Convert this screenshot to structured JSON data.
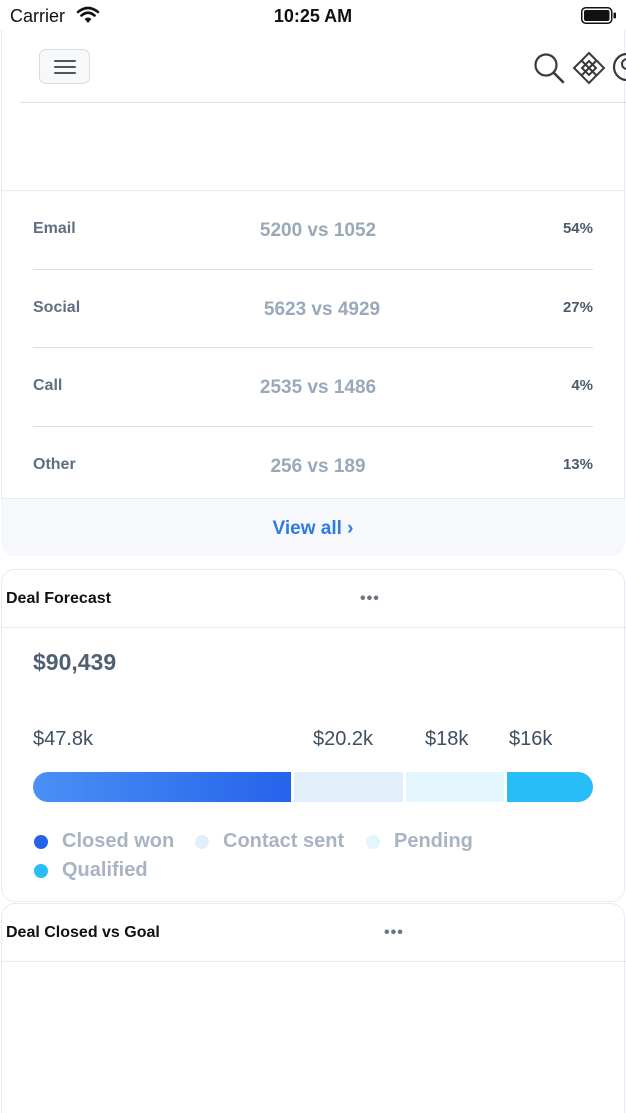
{
  "status_bar": {
    "carrier": "Carrier",
    "time": "10:25 AM"
  },
  "nav": {
    "menu_icon": "hamburger-icon",
    "search_icon": "search-icon",
    "apps_icon": "apps-icon",
    "avatar_icon": "user-avatar-icon"
  },
  "channels": {
    "rows": [
      {
        "label": "Email",
        "compare": "5200 vs 1052",
        "percent": "54%"
      },
      {
        "label": "Social",
        "compare": "5623 vs 4929",
        "percent": "27%"
      },
      {
        "label": "Call",
        "compare": "2535 vs 1486",
        "percent": "4%"
      },
      {
        "label": "Other",
        "compare": "256 vs 189",
        "percent": "13%"
      }
    ],
    "view_all": "View all ›"
  },
  "forecast": {
    "title": "Deal Forecast",
    "more": "•••",
    "total": "$90,439",
    "segments": [
      {
        "label": "Closed won",
        "amount": "$47.8k",
        "value": 47.8,
        "color": "#2563eb"
      },
      {
        "label": "Contact sent",
        "amount": "$20.2k",
        "value": 20.2,
        "color": "#e3eefb"
      },
      {
        "label": "Pending",
        "amount": "$18k",
        "value": 18,
        "color": "#e3f6fd"
      },
      {
        "label": "Qualified",
        "amount": "$16k",
        "value": 16,
        "color": "#28bdf7"
      }
    ]
  },
  "goal": {
    "title": "Deal Closed vs Goal",
    "more": "•••"
  }
}
